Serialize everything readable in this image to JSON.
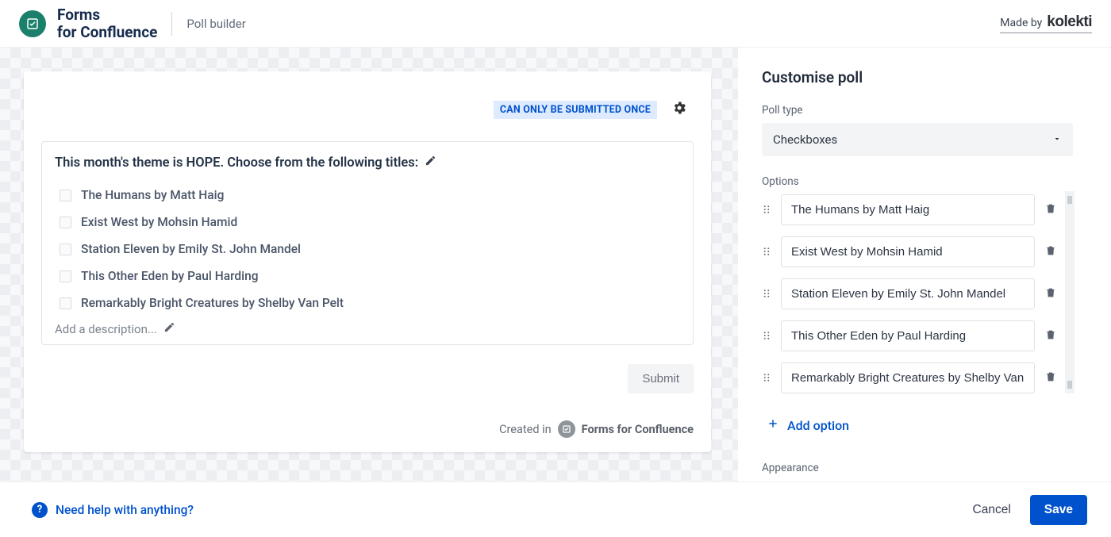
{
  "header": {
    "app_title_line1": "Forms",
    "app_title_line2": "for Confluence",
    "breadcrumb": "Poll builder",
    "made_by_label": "Made by",
    "brand": "kolekti"
  },
  "preview": {
    "submit_once_badge": "CAN ONLY BE SUBMITTED ONCE",
    "question": "This month's theme is HOPE. Choose from the following titles:",
    "options": [
      "The Humans by Matt Haig",
      "Exist West by Mohsin Hamid",
      "Station Eleven by Emily St. John Mandel",
      "This Other Eden by Paul Harding",
      "Remarkably Bright Creatures by Shelby Van Pelt"
    ],
    "description_placeholder": "Add a description...",
    "submit_label": "Submit",
    "created_in_prefix": "Created in",
    "created_in_app": "Forms for Confluence"
  },
  "sidebar": {
    "title": "Customise poll",
    "poll_type_label": "Poll type",
    "poll_type_value": "Checkboxes",
    "options_label": "Options",
    "options": [
      "The Humans by Matt Haig",
      "Exist West by Mohsin Hamid",
      "Station Eleven by Emily St. John Mandel",
      "This Other Eden by Paul Harding",
      "Remarkably Bright Creatures by Shelby Van Pelt"
    ],
    "add_option_label": "Add option",
    "appearance_label": "Appearance"
  },
  "footer": {
    "help_label": "Need help with anything?",
    "cancel_label": "Cancel",
    "save_label": "Save"
  }
}
